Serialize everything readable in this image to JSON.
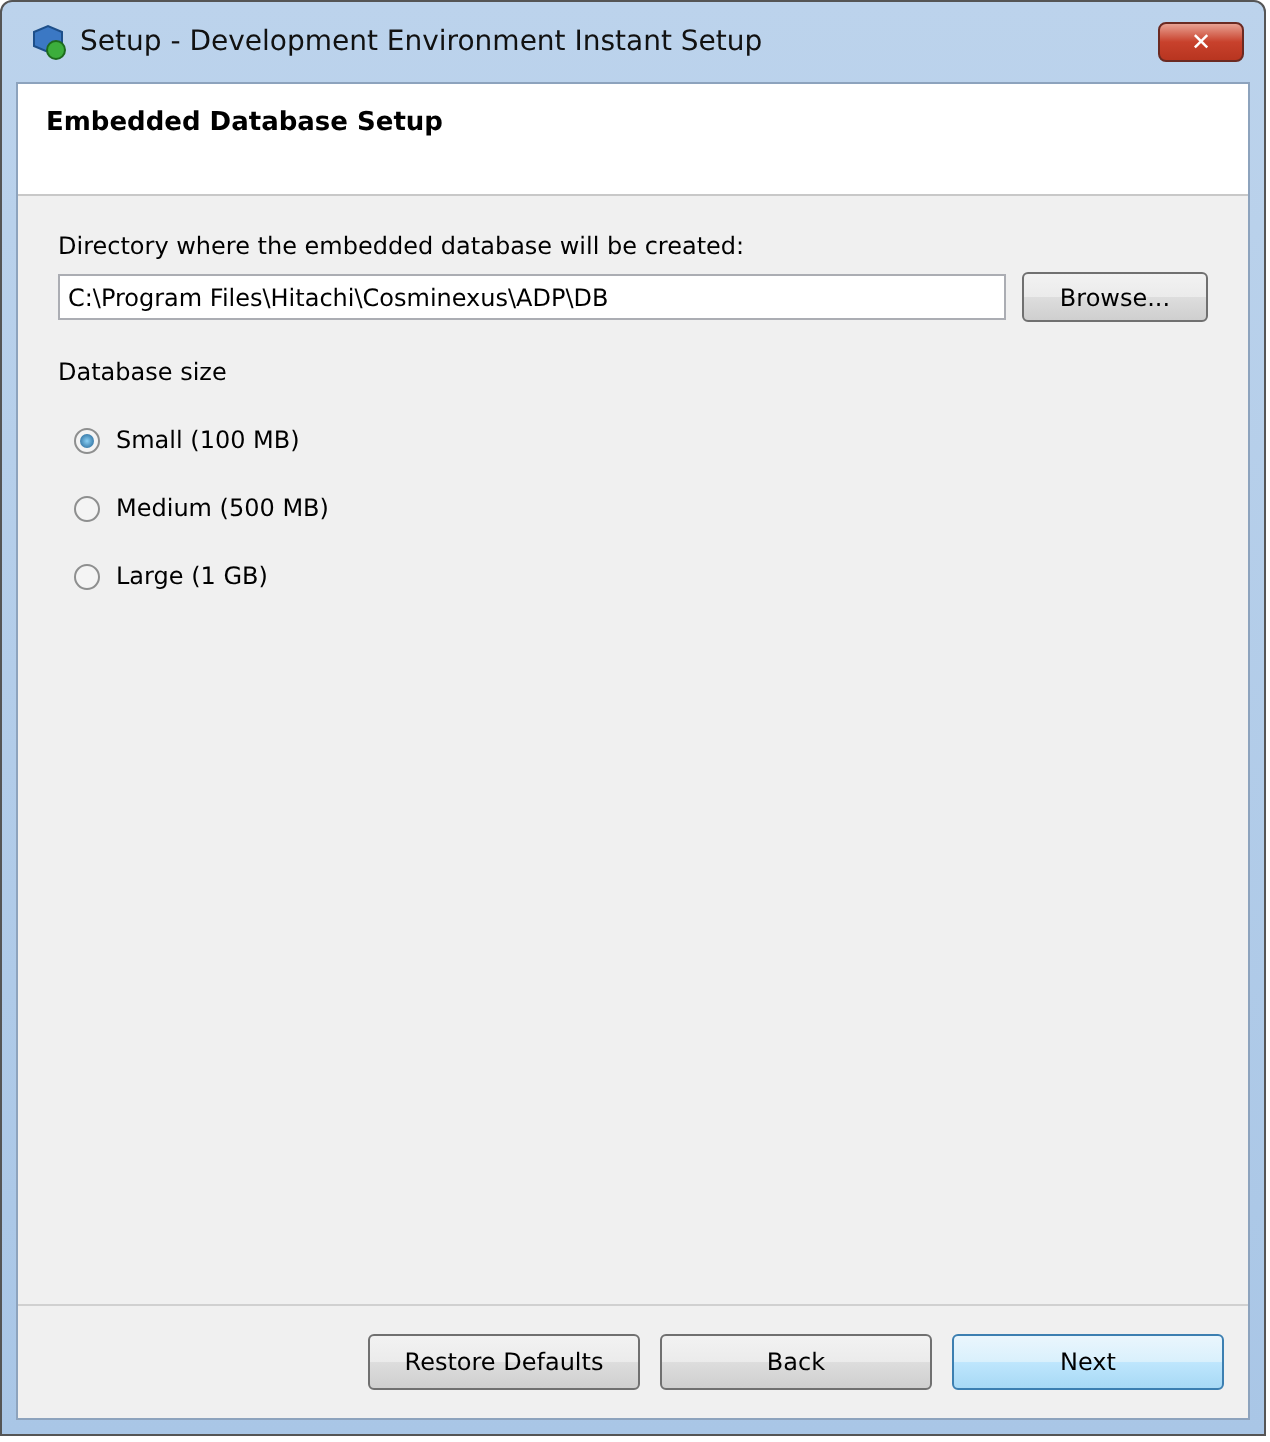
{
  "window": {
    "title": "Setup - Development Environment Instant Setup",
    "close": "✕"
  },
  "header": {
    "title": "Embedded Database Setup"
  },
  "directory": {
    "label": "Directory where the embedded database will be created:",
    "value": "C:\\Program Files\\Hitachi\\Cosminexus\\ADP\\DB",
    "button": "Browse..."
  },
  "size": {
    "label": "Database size",
    "options": [
      {
        "label": "Small (100 MB)",
        "selected": true
      },
      {
        "label": "Medium (500 MB)",
        "selected": false
      },
      {
        "label": "Large (1 GB)",
        "selected": false
      }
    ]
  },
  "buttons": [
    {
      "label": "Restore Defaults",
      "default": false
    },
    {
      "label": "Back",
      "default": false
    },
    {
      "label": "Next",
      "default": true
    }
  ]
}
